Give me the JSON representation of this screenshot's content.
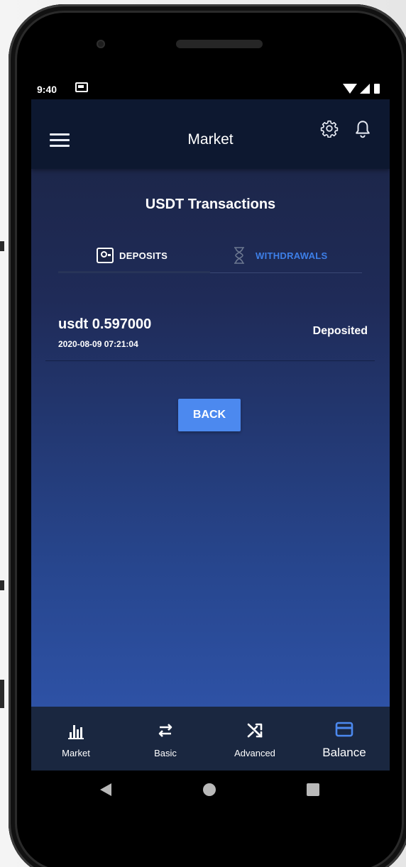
{
  "status_bar": {
    "time": "9:40"
  },
  "appbar": {
    "title": "Market",
    "icons": [
      "menu-icon",
      "gear-icon",
      "bell-icon"
    ]
  },
  "page": {
    "title": "USDT Transactions"
  },
  "tabs": [
    {
      "label": "DEPOSITS",
      "icon": "deposit-safe-icon",
      "selected": true
    },
    {
      "label": "WITHDRAWALS",
      "icon": "hourglass-icon",
      "selected": false
    }
  ],
  "transactions": [
    {
      "amount": "usdt 0.597000",
      "date": "2020-08-09 07:21:04",
      "status": "Deposited"
    }
  ],
  "back_button": {
    "label": "BACK"
  },
  "bottom_nav": [
    {
      "label": "Market",
      "icon": "bar-chart-icon",
      "active": false
    },
    {
      "label": "Basic",
      "icon": "swap-arrows-icon",
      "active": false
    },
    {
      "label": "Advanced",
      "icon": "shuffle-icon",
      "active": false
    },
    {
      "label": "Balance",
      "icon": "card-icon",
      "active": true
    }
  ],
  "colors": {
    "accent": "#4c89ef",
    "tab_inactive": "#3d7fe8",
    "appbar": "#0d1830",
    "bottom_nav": "#1a2740"
  }
}
